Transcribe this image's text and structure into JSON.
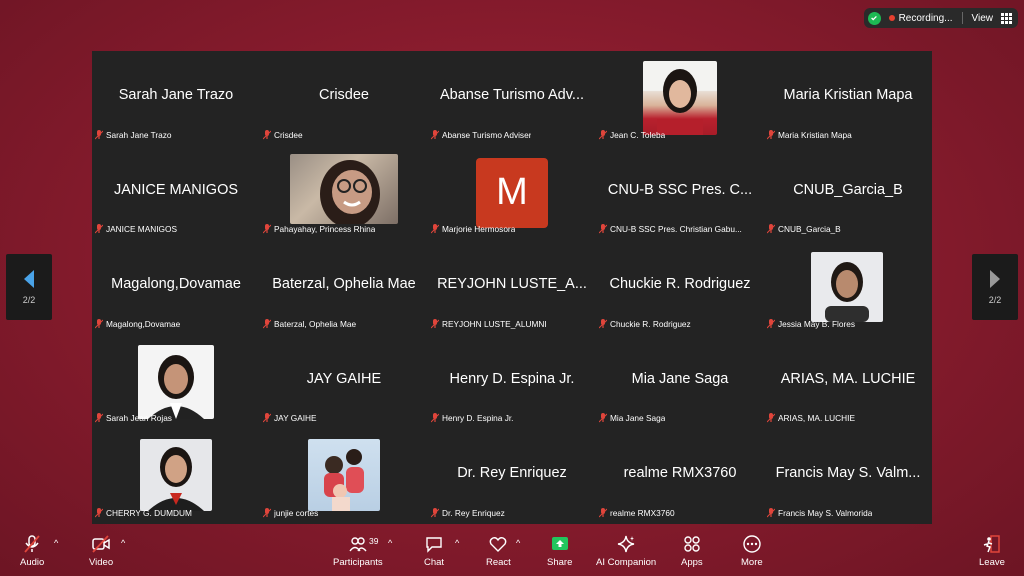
{
  "status": {
    "recording_label": "Recording...",
    "view_label": "View"
  },
  "page_indicator": "2/2",
  "participant_count": "39",
  "tiles": [
    {
      "name": "Sarah Jane Trazo",
      "label": "Sarah Jane Trazo"
    },
    {
      "name": "Crisdee",
      "label": "Crisdee"
    },
    {
      "name": "Abanse Turismo Adv...",
      "label": "Abanse Turismo Adviser"
    },
    {
      "name": "",
      "label": "Jean C. Toleba"
    },
    {
      "name": "Maria Kristian Mapa",
      "label": "Maria Kristian Mapa"
    },
    {
      "name": "JANICE MANIGOS",
      "label": "JANICE MANIGOS"
    },
    {
      "name": "",
      "label": "Pahayahay, Princess Rhina"
    },
    {
      "name": "M",
      "label": "Marjorie Hermosora"
    },
    {
      "name": "CNU-B SSC Pres. C...",
      "label": "CNU-B SSC Pres. Christian Gabu..."
    },
    {
      "name": "CNUB_Garcia_B",
      "label": "CNUB_Garcia_B"
    },
    {
      "name": "Magalong,Dovamae",
      "label": "Magalong,Dovamae"
    },
    {
      "name": "Baterzal, Ophelia Mae",
      "label": "Baterzal, Ophelia Mae"
    },
    {
      "name": "REYJOHN LUSTE_A...",
      "label": "REYJOHN LUSTE_ALUMNI"
    },
    {
      "name": "Chuckie R. Rodriguez",
      "label": "Chuckie R. Rodriguez"
    },
    {
      "name": "",
      "label": "Jessia May B. Flores"
    },
    {
      "name": "",
      "label": "Sarah Jean Rojas"
    },
    {
      "name": "JAY GAIHE",
      "label": "JAY GAIHE"
    },
    {
      "name": "Henry D. Espina Jr.",
      "label": "Henry D. Espina Jr."
    },
    {
      "name": "Mia Jane Saga",
      "label": "Mia Jane Saga"
    },
    {
      "name": "ARIAS,  MA. LUCHIE",
      "label": "ARIAS,  MA. LUCHIE"
    },
    {
      "name": "",
      "label": "CHERRY G. DUMDUM"
    },
    {
      "name": "",
      "label": "junjie cortes"
    },
    {
      "name": "Dr. Rey  Enriquez",
      "label": "Dr. Rey  Enriquez"
    },
    {
      "name": "realme RMX3760",
      "label": "realme RMX3760"
    },
    {
      "name": "Francis May S. Valm...",
      "label": "Francis May S. Valmorida"
    }
  ],
  "toolbar": {
    "audio": "Audio",
    "video": "Video",
    "participants": "Participants",
    "chat": "Chat",
    "react": "React",
    "share": "Share",
    "ai_companion": "AI Companion",
    "apps": "Apps",
    "more": "More",
    "leave": "Leave"
  },
  "colors": {
    "background": "#8a1c2e",
    "gallery": "#232323",
    "mic_off": "#e0453b",
    "share_green": "#22c55e",
    "avatar_m": "#c8391f"
  }
}
